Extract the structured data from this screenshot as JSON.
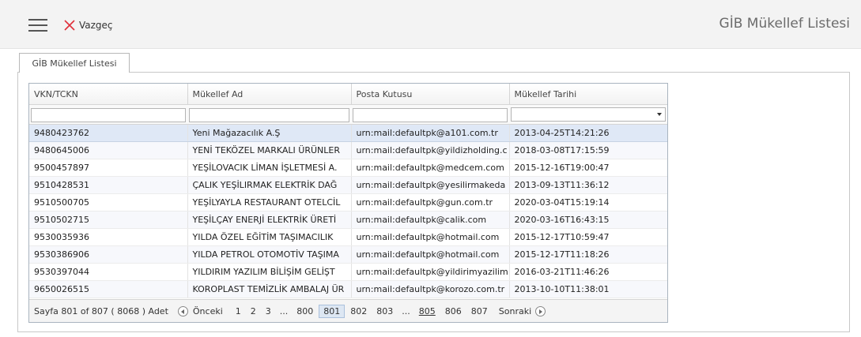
{
  "header": {
    "cancel_label": "Vazgeç",
    "title": "GİB Mükellef Listesi",
    "menu_icon": "hamburger-icon",
    "cancel_icon": "close-x-icon",
    "cancel_icon_color": "#e0303a"
  },
  "tab": {
    "label": "GİB Mükellef Listesi"
  },
  "grid": {
    "columns": [
      "VKN/TCKN",
      "Mükellef Ad",
      "Posta Kutusu",
      "Mükellef Tarihi"
    ],
    "selected_color": "#dfe8f6",
    "rows": [
      [
        "9480423762",
        "Yeni Mağazacılık A.Ş",
        "urn:mail:defaultpk@a101.com.tr",
        "2013-04-25T14:21:26"
      ],
      [
        "9480645006",
        "YENİ TEKÖZEL MARKALI ÜRÜNLER",
        "urn:mail:defaultpk@yildizholding.c",
        "2018-03-08T17:15:59"
      ],
      [
        "9500457897",
        "YEŞİLOVACIK LİMAN İŞLETMESİ A.",
        "urn:mail:defaultpk@medcem.com",
        "2015-12-16T19:00:47"
      ],
      [
        "9510428531",
        "ÇALIK YEŞİLIRMAK ELEKTRİK DAĞ",
        "urn:mail:defaultpk@yesilirmakeda",
        "2013-09-13T11:36:12"
      ],
      [
        "9510500705",
        "YEŞİLYAYLA RESTAURANT OTELCİL",
        "urn:mail:defaultpk@gun.com.tr",
        "2020-03-04T15:19:14"
      ],
      [
        "9510502715",
        "YEŞİLÇAY ENERJİ ELEKTRİK ÜRETİ",
        "urn:mail:defaultpk@calik.com",
        "2020-03-16T16:43:15"
      ],
      [
        "9530035936",
        "YILDA ÖZEL EĞİTİM TAŞIMACILIK",
        "urn:mail:defaultpk@hotmail.com",
        "2015-12-17T10:59:47"
      ],
      [
        "9530386906",
        "YILDA PETROL OTOMOTİV TAŞIMA",
        "urn:mail:defaultpk@hotmail.com",
        "2015-12-17T11:18:26"
      ],
      [
        "9530397044",
        "YILDIRIM YAZILIM BİLİŞİM GELİŞT",
        "urn:mail:defaultpk@yildirimyazilim",
        "2016-03-21T11:46:26"
      ],
      [
        "9650026515",
        "KOROPLAST TEMİZLİK AMBALAJ ÜR",
        "urn:mail:defaultpk@korozo.com.tr",
        "2013-10-10T11:38:01"
      ]
    ]
  },
  "pager": {
    "summary": "Sayfa 801 of 807 ( 8068 ) Adet",
    "prev_label": "Önceki",
    "next_label": "Sonraki",
    "pages": [
      "1",
      "2",
      "3",
      "...",
      "800",
      "801",
      "802",
      "803",
      "...",
      "805",
      "806",
      "807"
    ],
    "current": "801"
  }
}
